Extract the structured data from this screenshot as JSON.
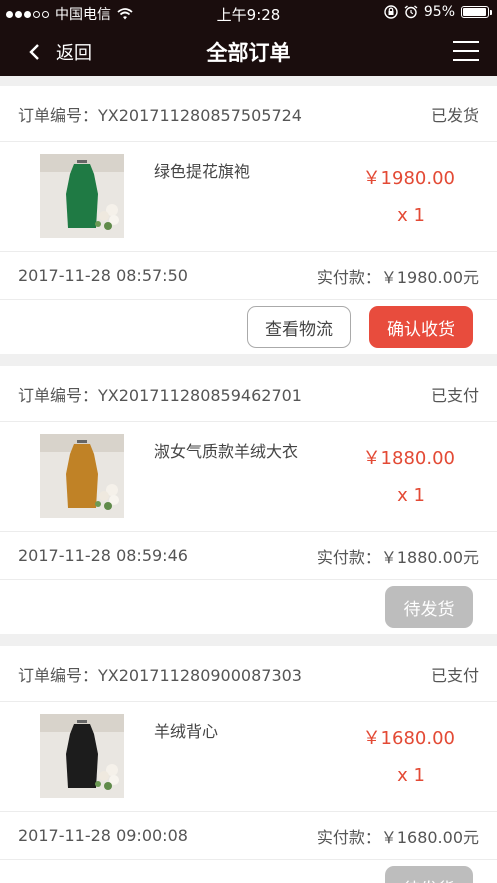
{
  "status_bar": {
    "carrier": "中国电信",
    "time": "上午9:28",
    "battery": "95%",
    "battery_level": 0.95
  },
  "nav": {
    "back_label": "返回",
    "title": "全部订单"
  },
  "order_no_label": "订单编号：",
  "paid_label": "实付款：",
  "orders": [
    {
      "order_no": "YX201711280857505724",
      "status": "已发货",
      "item_name": "绿色提花旗袍",
      "price": "￥1980.00",
      "qty": "x 1",
      "time": "2017-11-28 08:57:50",
      "paid": "￥1980.00元",
      "buttons": [
        "查看物流",
        "确认收货"
      ],
      "image_color": "#1f7a44"
    },
    {
      "order_no": "YX201711280859462701",
      "status": "已支付",
      "item_name": "淑女气质款羊绒大衣",
      "price": "￥1880.00",
      "qty": "x 1",
      "time": "2017-11-28 08:59:46",
      "paid": "￥1880.00元",
      "buttons": [
        "待发货"
      ],
      "image_color": "#c08226"
    },
    {
      "order_no": "YX201711280900087303",
      "status": "已支付",
      "item_name": "羊绒背心",
      "price": "￥1680.00",
      "qty": "x 1",
      "time": "2017-11-28 09:00:08",
      "paid": "￥1680.00元",
      "buttons": [
        "待发货"
      ],
      "image_color": "#1c1c1c"
    }
  ]
}
